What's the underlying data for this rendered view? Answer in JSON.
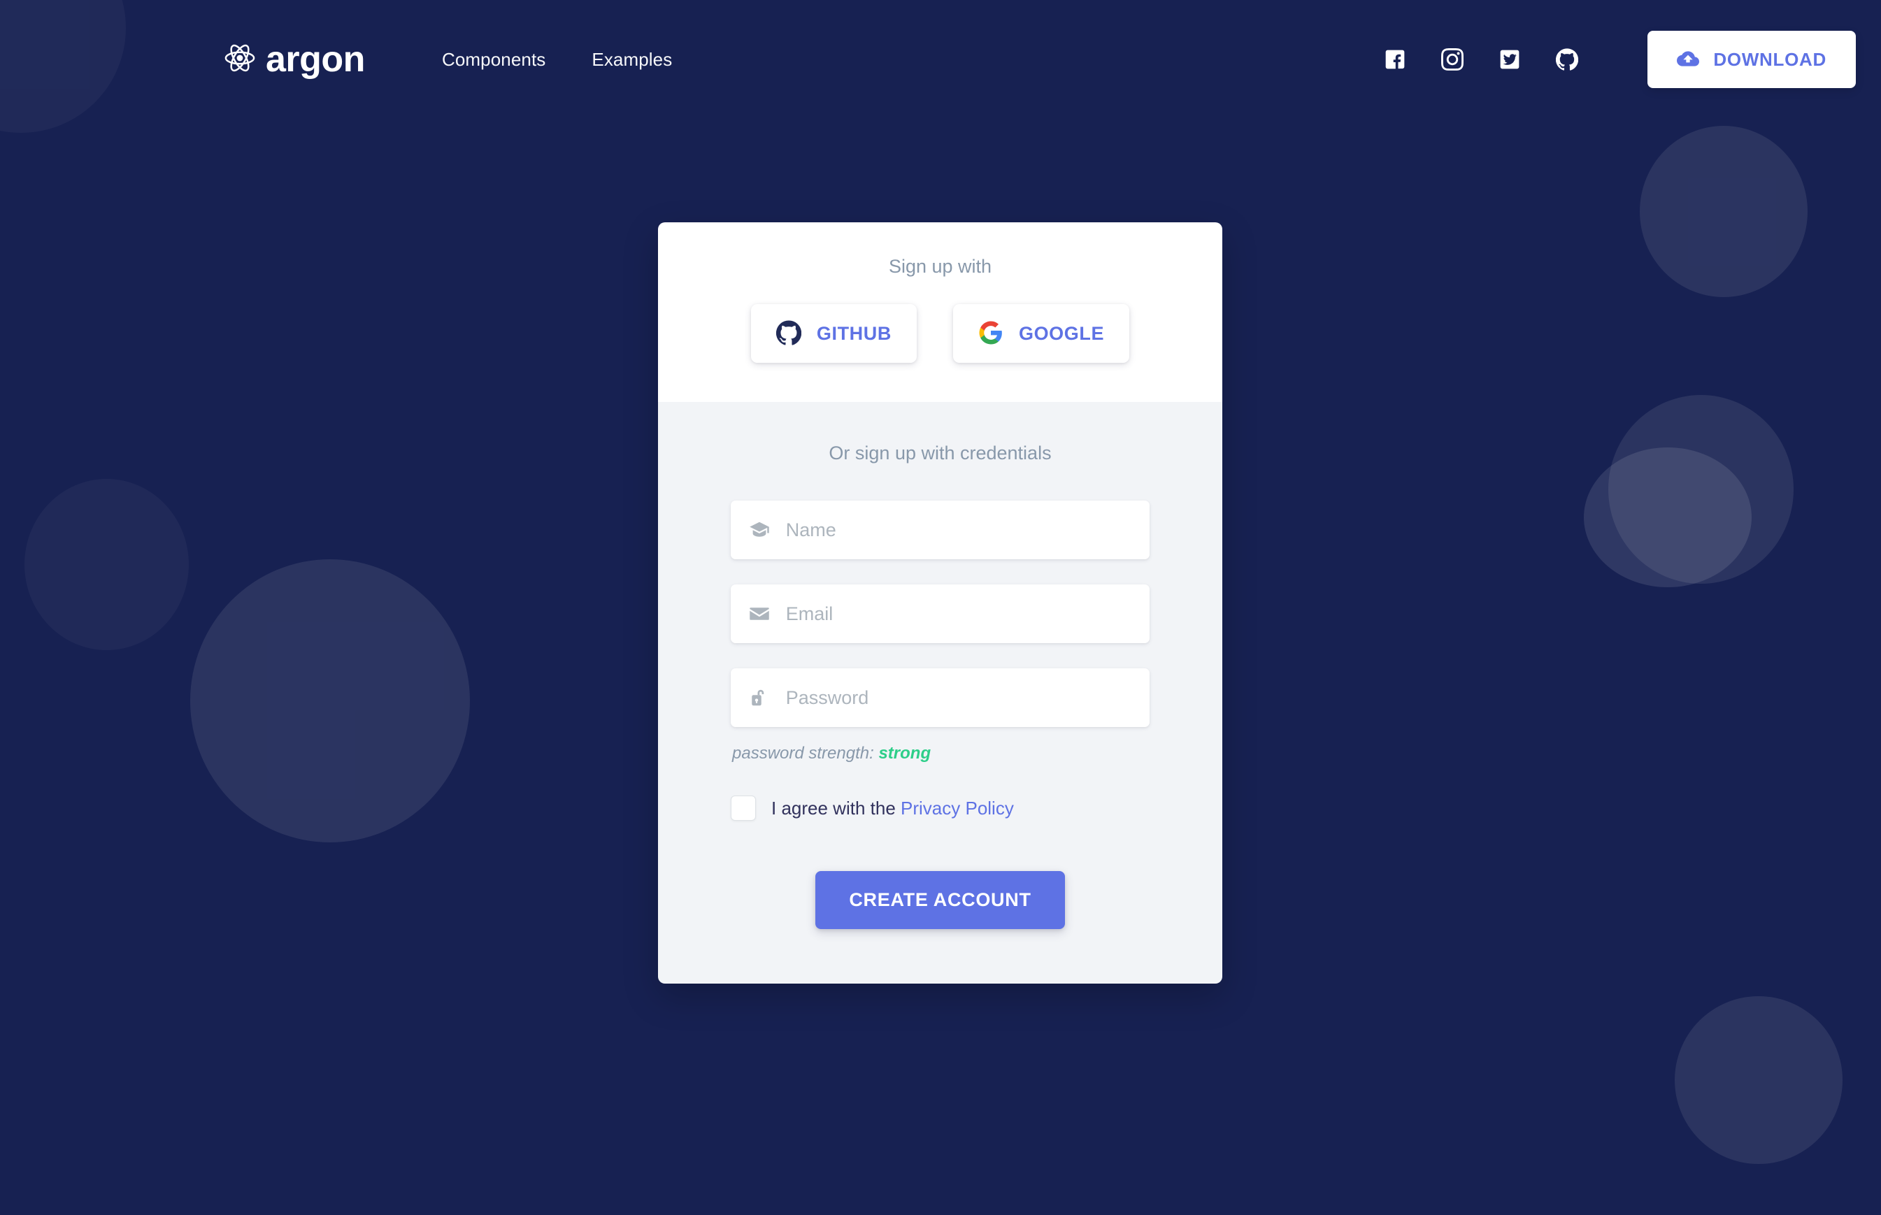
{
  "theme": {
    "background": "#172152",
    "accent": "#5e72e4",
    "card_top_bg": "#ffffff",
    "card_body_bg": "#f2f4f7",
    "muted_text": "#8898aa",
    "strength_color": "#2dce89",
    "dark_text": "#32325d"
  },
  "navbar": {
    "brand": {
      "text": "argon",
      "icon": "atom-icon"
    },
    "links": [
      {
        "label": "Components",
        "name": "nav-link-components"
      },
      {
        "label": "Examples",
        "name": "nav-link-examples"
      }
    ],
    "social": [
      {
        "name": "facebook-icon",
        "title": "Facebook"
      },
      {
        "name": "instagram-icon",
        "title": "Instagram"
      },
      {
        "name": "twitter-icon",
        "title": "Twitter"
      },
      {
        "name": "github-icon",
        "title": "GitHub"
      }
    ],
    "download": {
      "label": "DOWNLOAD",
      "icon": "cloud-download-icon"
    }
  },
  "card": {
    "signup_with_label": "Sign up with",
    "social_buttons": [
      {
        "label": "GITHUB",
        "icon": "github-icon"
      },
      {
        "label": "GOOGLE",
        "icon": "google-icon"
      }
    ],
    "credentials_label": "Or sign up with credentials",
    "fields": [
      {
        "placeholder": "Name",
        "icon": "graduation-cap-icon",
        "value": ""
      },
      {
        "placeholder": "Email",
        "icon": "envelope-icon",
        "value": ""
      },
      {
        "placeholder": "Password",
        "icon": "unlocked-padlock-icon",
        "value": ""
      }
    ],
    "password_strength": {
      "prefix": "password strength:",
      "value": "strong"
    },
    "agreement": {
      "text": "I agree with the",
      "link_label": "Privacy Policy",
      "checked": false
    },
    "submit_label": "CREATE ACCOUNT"
  }
}
